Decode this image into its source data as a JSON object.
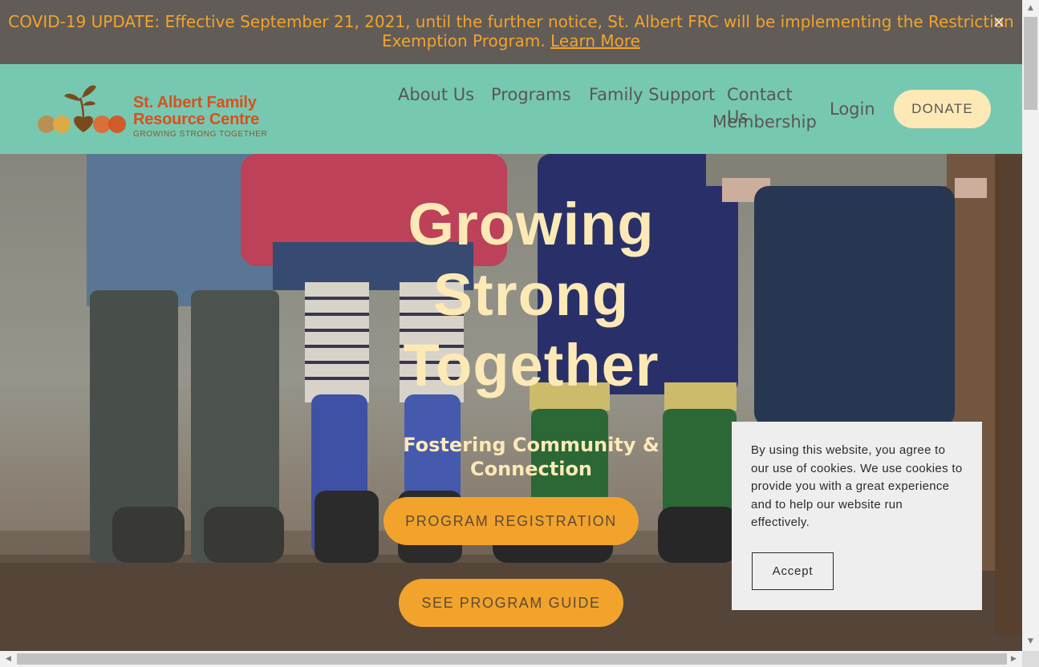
{
  "announcement": {
    "text": "COVID-19 UPDATE: Effective September 21, 2021, until the further notice, St. Albert FRC will be implementing the Restriction Exemption Program.",
    "link": "Learn More",
    "close": "×"
  },
  "logo": {
    "line1": "St. Albert Family",
    "line2": "Resource Centre",
    "tagline": "GROWING STRONG TOGETHER"
  },
  "nav": {
    "items": [
      "About Us",
      "Programs",
      "Family Support",
      "Contact Us",
      "Membership"
    ],
    "login": "Login",
    "donate": "DONATE"
  },
  "hero": {
    "title_lines": [
      "Growing",
      "Strong",
      "Together"
    ],
    "subtitle": "Fostering Community & Connection",
    "btn_registration": "PROGRAM REGISTRATION",
    "btn_guide": "SEE PROGRAM GUIDE"
  },
  "cookie": {
    "text": "By using this website, you agree to our use of cookies. We use cookies to provide you with a great experience and to help our website run effectively.",
    "accept": "Accept"
  },
  "colors": {
    "announce_bg": "#615c58",
    "announce_text": "#f2a32b",
    "header_bg": "#77c8b1",
    "accent_cream": "#fde9b6",
    "accent_orange": "#f2a32b",
    "logo_orange": "#d9501e"
  }
}
